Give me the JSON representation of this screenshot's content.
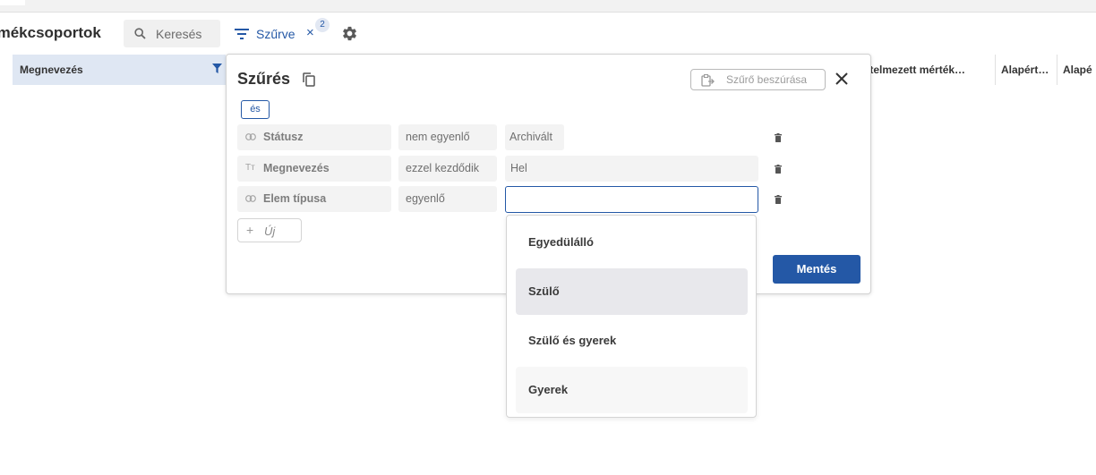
{
  "header": {
    "page_title": "rmékcsoportok",
    "search": {
      "placeholder": "Keresés",
      "value": ""
    },
    "filter_toggle_label": "Szűrve",
    "clear_symbol": "×",
    "active_filter_count": "2",
    "icons": [
      "search-icon",
      "filter-lines-icon",
      "close-icon",
      "gear-icon"
    ]
  },
  "table": {
    "columns": [
      "Megnevezés",
      "értelmezett mérték…",
      "Alapért…",
      "Alapé"
    ],
    "active_filter_color": "#2458a6"
  },
  "filter_panel": {
    "title": "Szűrés",
    "paste_label": "Szűrő beszúrása",
    "logic_operator": "és",
    "rules": [
      {
        "field": "Státusz",
        "field_icon": "link-icon",
        "operator": "nem egyenlő",
        "value": "Archivált"
      },
      {
        "field": "Megnevezés",
        "field_icon": "text-type-icon",
        "field_icon_glyph": "Tт",
        "operator": "ezzel kezdődik",
        "value": "Hel"
      },
      {
        "field": "Elem típusa",
        "field_icon": "link-icon",
        "operator": "egyenlő",
        "value": ""
      }
    ],
    "new_rule_plus": "+",
    "new_rule_label": "Új",
    "save_label": "Mentés",
    "accent_color": "#2458a6"
  },
  "dropdown": {
    "options": [
      "Egyedülálló",
      "Szülő",
      "Szülő és gyerek",
      "Gyerek"
    ],
    "highlighted": "Szülő"
  }
}
